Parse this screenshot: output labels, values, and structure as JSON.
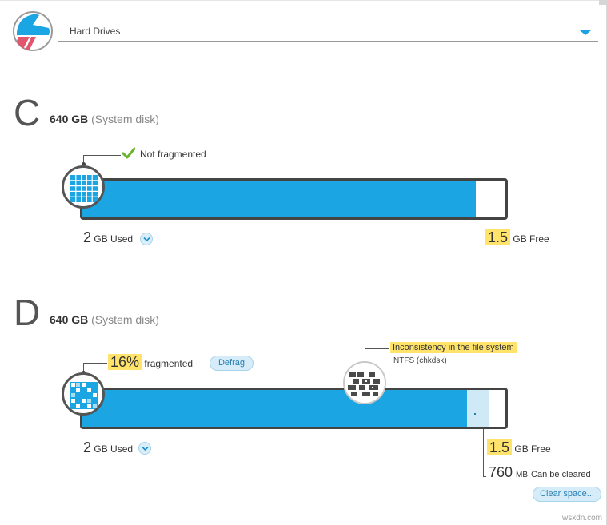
{
  "header": {
    "title": "Hard Drives",
    "accent": "#1ba5e2"
  },
  "drives": [
    {
      "letter": "C",
      "size": "640 GB",
      "desc": "(System disk)",
      "frag_status": "Not fragmented",
      "used_num": "2",
      "used_label": "GB Used",
      "free_num": "1.5",
      "free_label": "GB Free",
      "used_fraction": 0.93
    },
    {
      "letter": "D",
      "size": "640 GB",
      "desc": "(System disk)",
      "frag_pct": "16%",
      "frag_label": "fragmented",
      "defrag_label": "Defrag",
      "issue_title": "Inconsistency in the file system",
      "issue_sub": "NTFS (chkdsk)",
      "used_num": "2",
      "used_label": "GB Used",
      "free_num": "1.5",
      "free_label": "GB Free",
      "clear_num": "760",
      "clear_unit": "MB",
      "clear_text": "Can be cleared",
      "clear_button": "Clear space...",
      "used_fraction": 0.91,
      "clearable_fraction": 0.05
    }
  ],
  "watermark": "wsxdn.com",
  "colors": {
    "bar_fill": "#1ba5e2",
    "highlight": "#ffe36b",
    "check": "#6ab42e"
  }
}
